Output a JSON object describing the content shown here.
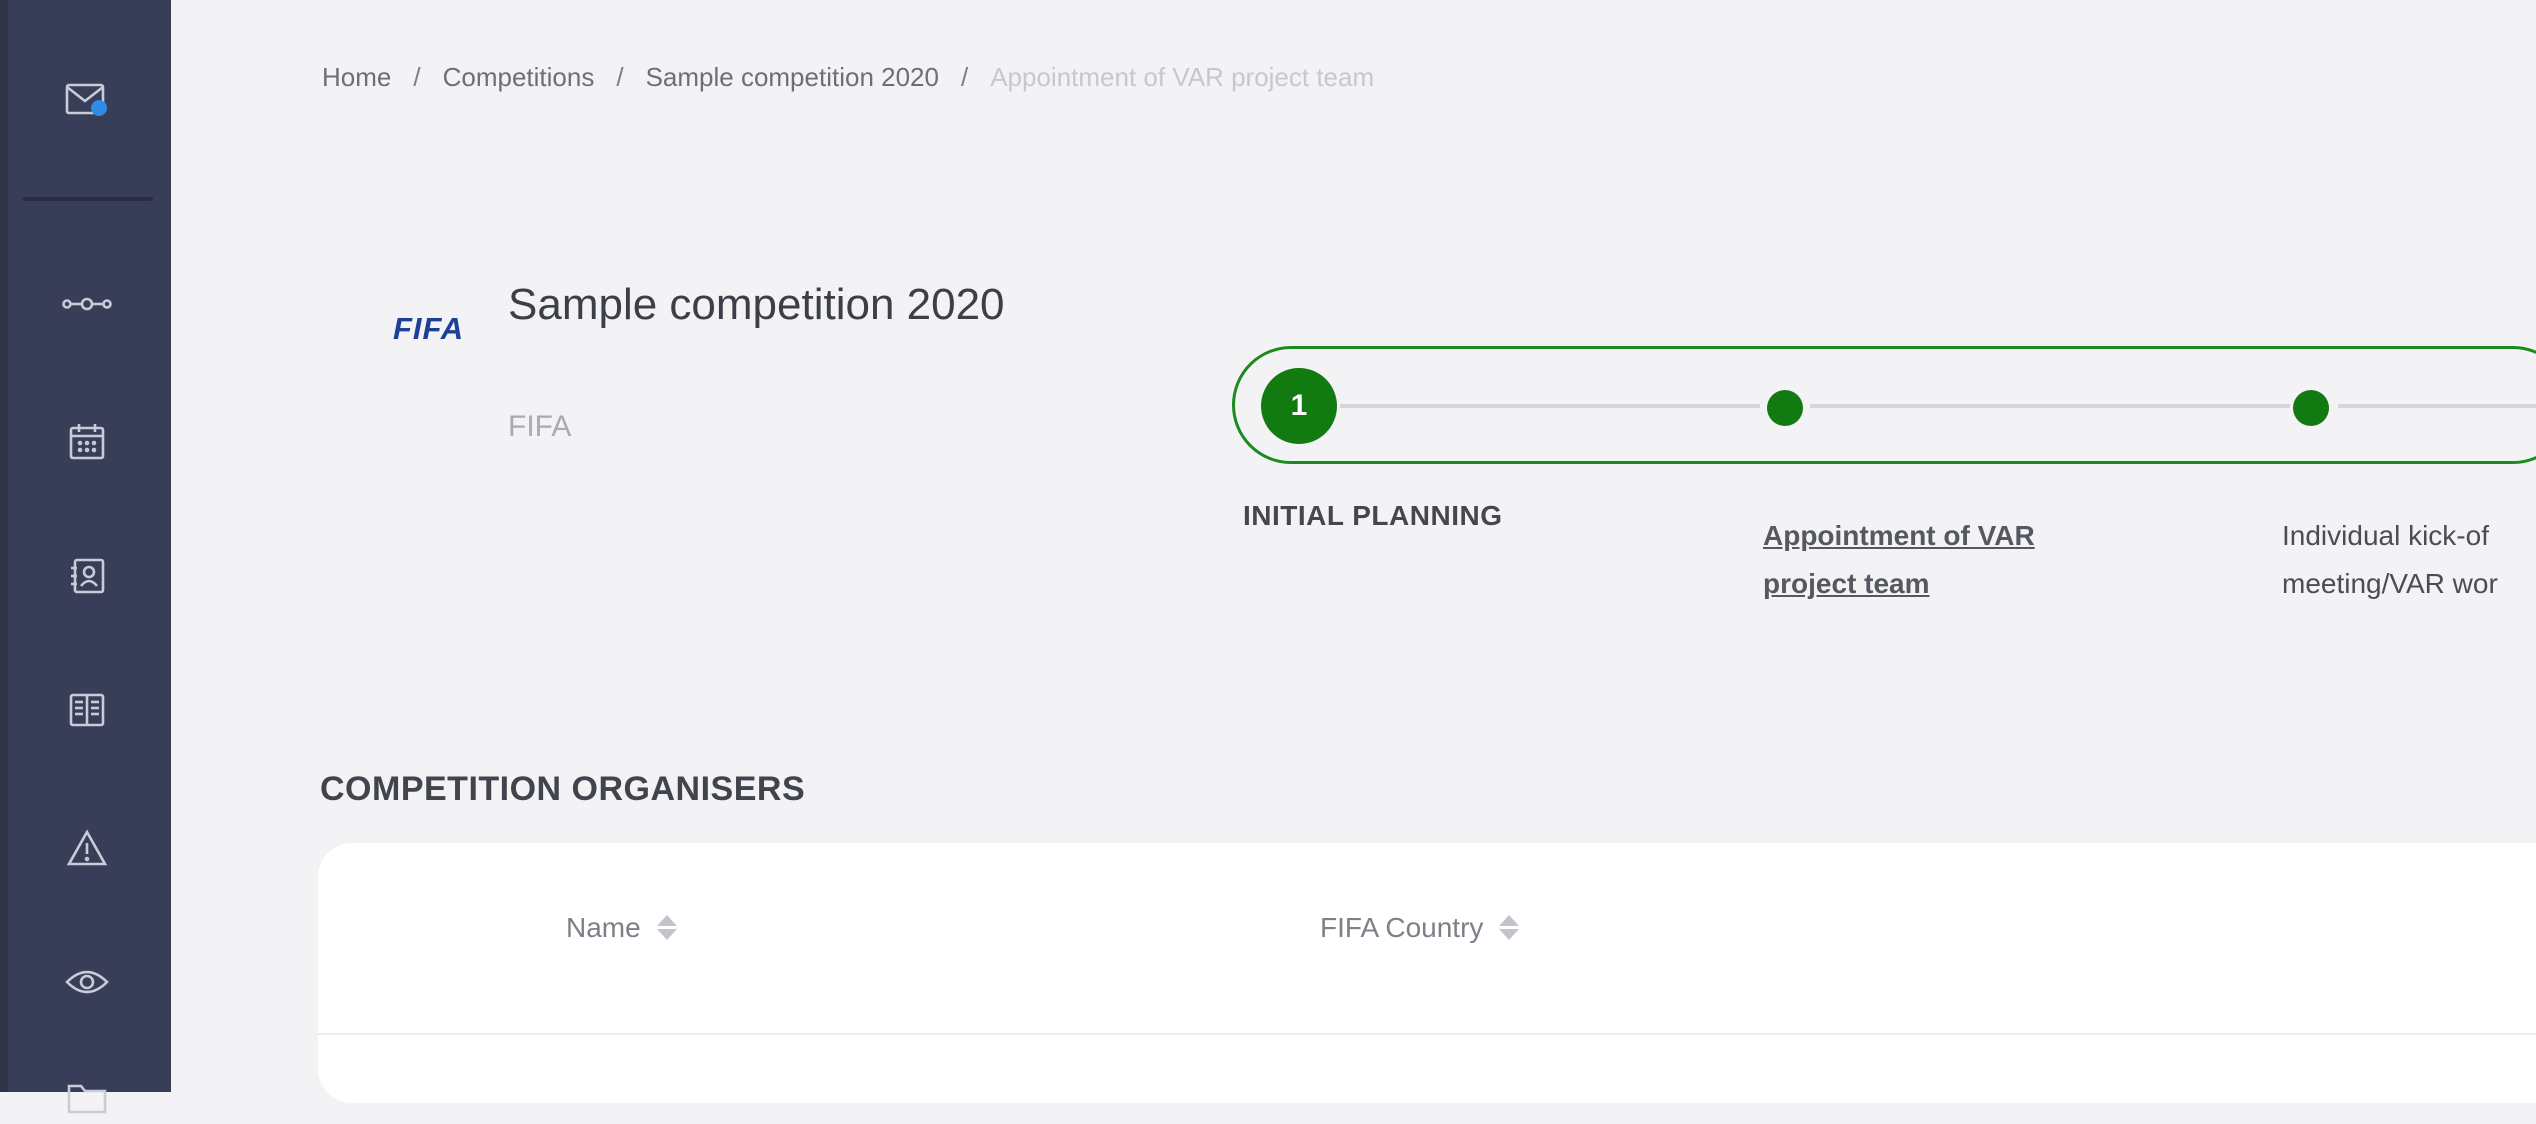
{
  "breadcrumb": {
    "home": "Home",
    "competitions": "Competitions",
    "competition": "Sample competition 2020",
    "current": "Appointment of VAR project team",
    "separator": "/"
  },
  "header": {
    "logo_text": "FIFA",
    "title": "Sample competition 2020",
    "subtitle": "FIFA"
  },
  "progress": {
    "current_step": "1",
    "steps": [
      {
        "label_line1": "INITIAL PLANNING",
        "label_line2": ""
      },
      {
        "label_line1": "Appointment of VAR",
        "label_line2": "project team"
      },
      {
        "label_line1": "Individual kick-of",
        "label_line2": "meeting/VAR wor"
      }
    ]
  },
  "section": {
    "title": "COMPETITION ORGANISERS"
  },
  "table": {
    "columns": [
      "Name",
      "FIFA Country"
    ]
  },
  "sidebar": {
    "icons": [
      "mail-icon",
      "workflow-icon",
      "calendar-icon",
      "contacts-icon",
      "book-icon",
      "warning-icon",
      "eye-icon",
      "folder-icon"
    ],
    "notification_color": "#2f8be6"
  },
  "colors": {
    "accent_green": "#117a11",
    "sidebar_bg": "#383e57",
    "logo_blue": "#1e3f98"
  }
}
